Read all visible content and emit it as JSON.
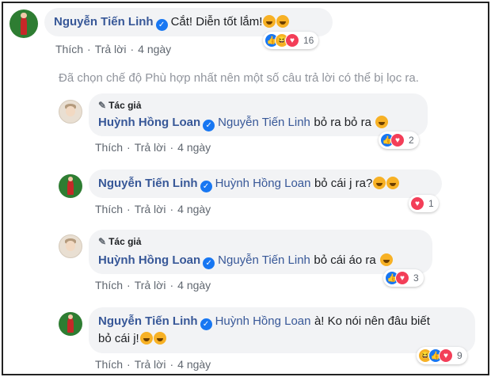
{
  "reply_label": "Trả lời",
  "like_label": "Thích",
  "notice": "Đã chọn chế độ Phù hợp nhất nên một số câu trả lời có thể bị lọc ra.",
  "comments": [
    {
      "author": "Nguyễn Tiến Linh",
      "text": "Cắt! Diễn tốt lắm!",
      "time": "4 ngày",
      "reactions": [
        "like-icon",
        "haha-icon",
        "love-icon"
      ],
      "count": "16"
    },
    {
      "author_badge": "Tác giả",
      "author": "Huỳnh Hồng Loan",
      "mention": "Nguyễn Tiến Linh",
      "text": "bỏ ra bỏ ra",
      "time": "4 ngày",
      "reactions": [
        "like-icon",
        "love-icon"
      ],
      "count": "2"
    },
    {
      "author": "Nguyễn Tiến Linh",
      "mention": "Huỳnh Hồng Loan",
      "text": "bỏ cái j ra?",
      "time": "4 ngày",
      "reactions": [
        "love-icon"
      ],
      "count": "1"
    },
    {
      "author_badge": "Tác giả",
      "author": "Huỳnh Hồng Loan",
      "mention": "Nguyễn Tiến Linh",
      "text": "bỏ cái áo ra",
      "time": "4 ngày",
      "reactions": [
        "like-icon",
        "love-icon"
      ],
      "count": "3"
    },
    {
      "author": "Nguyễn Tiến Linh",
      "mention": "Huỳnh Hồng Loan",
      "text_line1": "à! Ko nói nên đâu biết",
      "text_line2": "bỏ cái j!",
      "time": "4 ngày",
      "reactions": [
        "haha-icon",
        "like-icon",
        "love-icon"
      ],
      "count": "9"
    }
  ],
  "colors": {
    "link": "#385898",
    "bubble": "#f2f3f5",
    "like": "#1877f2",
    "love": "#f33e58",
    "haha": "#f7b125"
  }
}
